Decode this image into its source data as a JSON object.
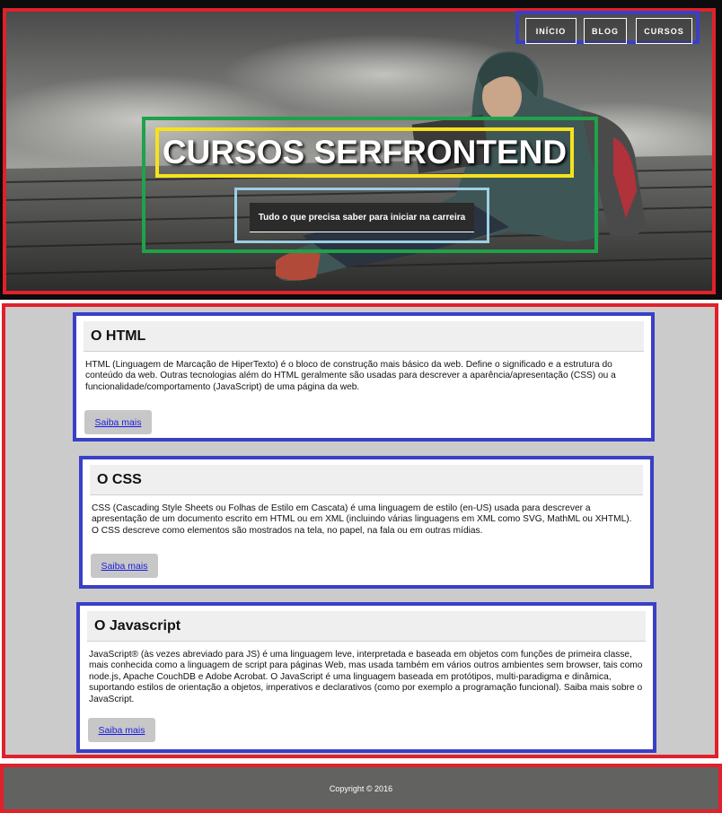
{
  "nav": {
    "items": [
      "INÍCIO",
      "BLOG",
      "CURSOS"
    ]
  },
  "hero": {
    "title": "CURSOS SERFRONTEND",
    "subtitle": "Tudo o que precisa saber para iniciar na carreira"
  },
  "cards": [
    {
      "title": "O HTML",
      "text": "HTML (Linguagem de Marcação de HiperTexto) é o bloco de construção mais básico da web. Define o significado e a estrutura do conteúdo da web. Outras tecnologias além do HTML geralmente são usadas para descrever a aparência/apresentação (CSS) ou a funcionalidade/comportamento (JavaScript) de uma página da web.",
      "button": "Saiba mais"
    },
    {
      "title": "O CSS",
      "text": "CSS (Cascading Style Sheets ou Folhas de Estilo em Cascata) é uma linguagem de estilo (en-US) usada para descrever a apresentação de um documento escrito em HTML ou em XML (incluindo várias linguagens em XML como SVG, MathML ou XHTML). O CSS descreve como elementos são mostrados na tela, no papel, na fala ou em outras mídias.",
      "button": "Saiba mais"
    },
    {
      "title": "O Javascript",
      "text": "JavaScript® (às vezes abreviado para JS) é uma linguagem leve, interpretada e baseada em objetos com funções de primeira classe, mais conhecida como a linguagem de script para páginas Web, mas usada também em vários outros ambientes sem browser, tais como node.js, Apache CouchDB e Adobe Acrobat. O JavaScript é uma linguagem baseada em protótipos, multi-paradigma e dinâmica, suportando estilos de orientação a objetos, imperativos e declarativos (como por exemplo a programação funcional). Saiba mais sobre o JavaScript.",
      "button": "Saiba mais"
    }
  ],
  "footer": {
    "text": "Copyright © 2016"
  },
  "icons": [
    "hero-background-image"
  ],
  "colors": {
    "region_outline": "#e0212b",
    "card_outline": "#3a3fc7",
    "hero_box_outline": "#1fa24a",
    "title_outline": "#f5e21d",
    "subtitle_outline": "#9ccfe3",
    "main_bg": "#cbcbcb",
    "footer_bg": "#626260",
    "link": "#1a1ae0"
  }
}
